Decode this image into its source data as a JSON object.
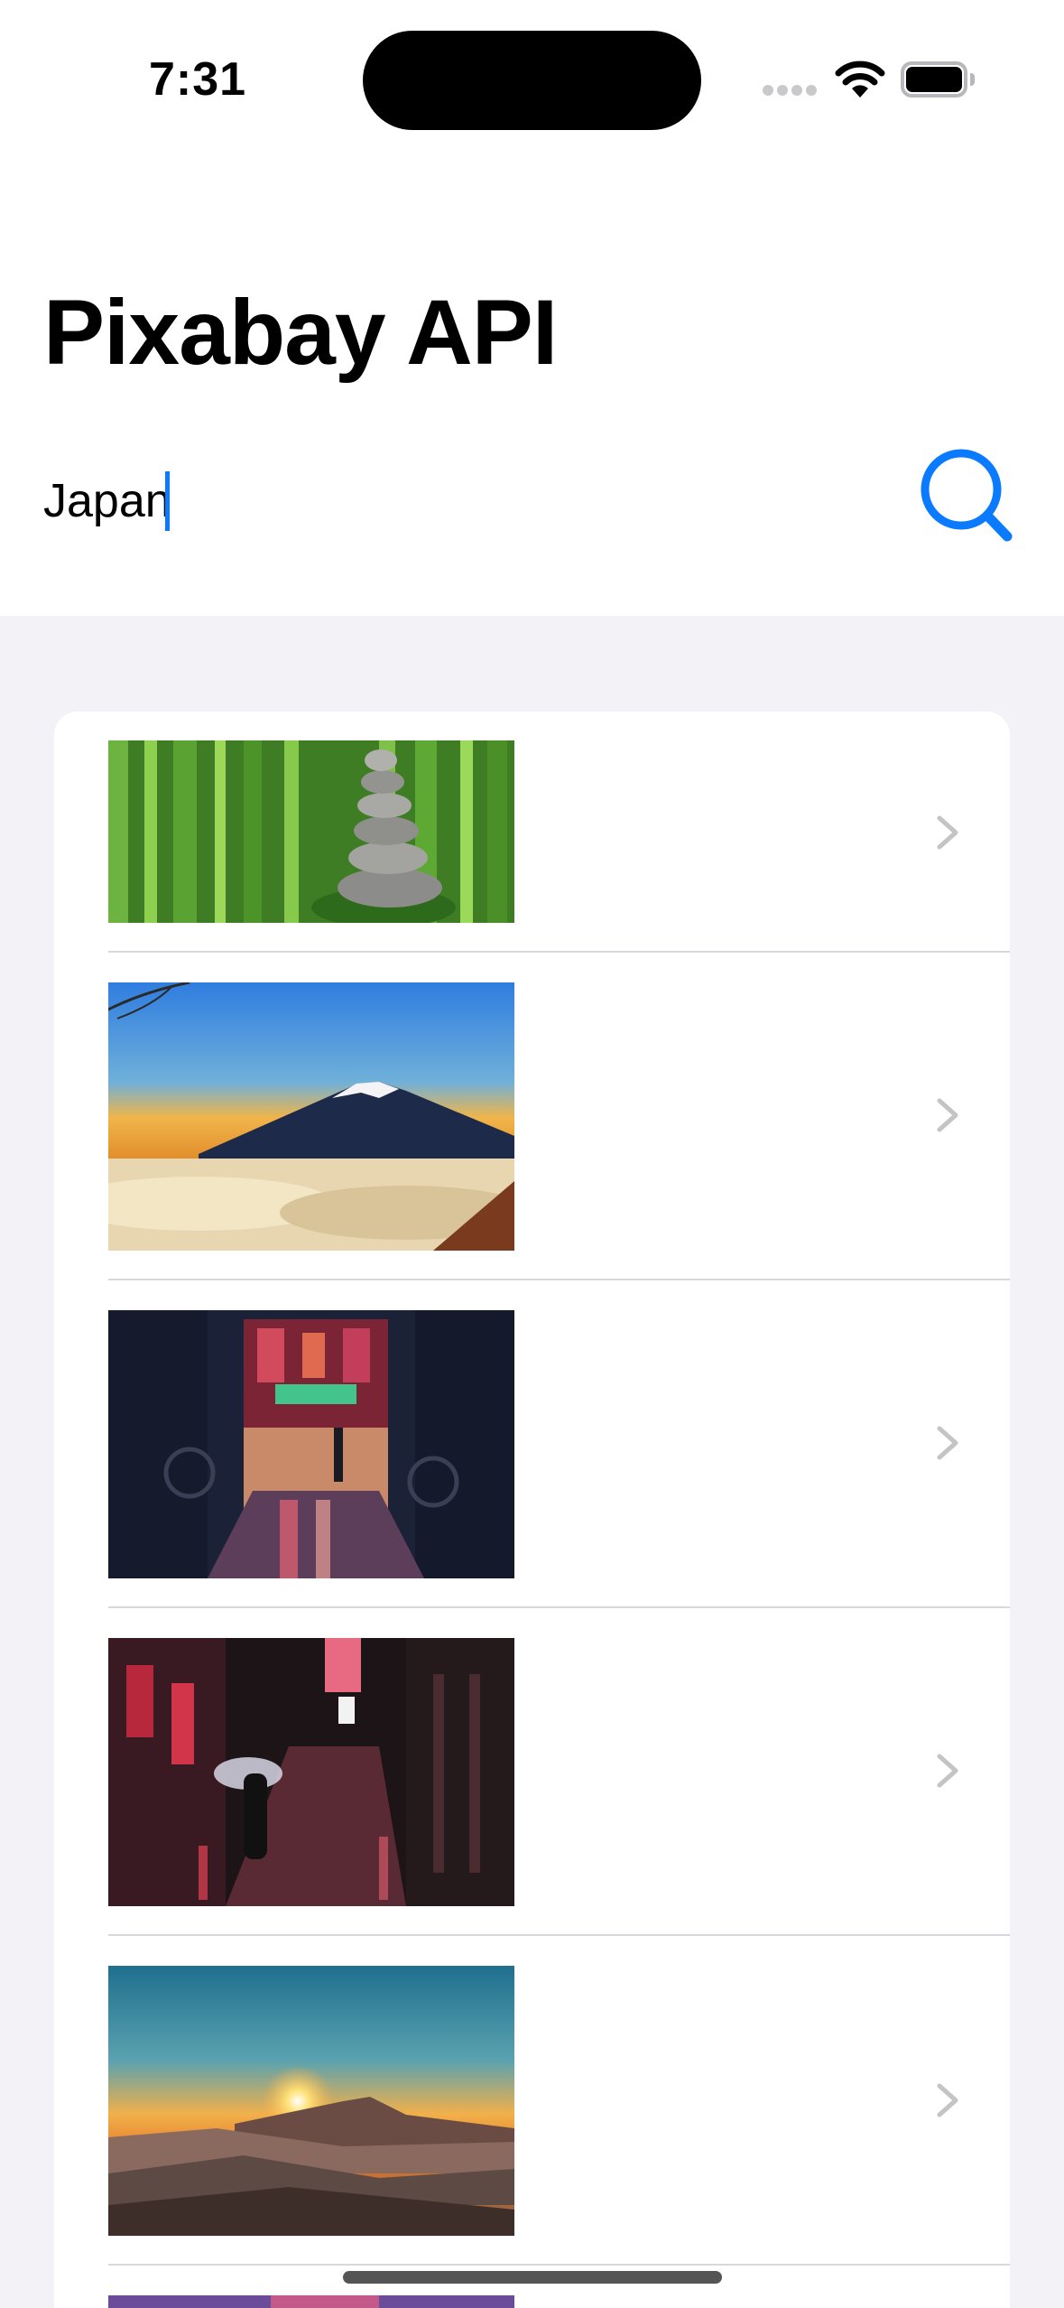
{
  "status": {
    "time": "7:31"
  },
  "header": {
    "title": "Pixabay API"
  },
  "search": {
    "value": "Japan",
    "button_icon": "magnifying-glass-icon",
    "accent_color": "#0A7AFF"
  },
  "results": [
    {
      "subject": "bamboo-with-stone-stack",
      "chevron": "chevron-right-icon"
    },
    {
      "subject": "mount-fuji-sunset",
      "chevron": "chevron-right-icon"
    },
    {
      "subject": "neon-alley-night",
      "chevron": "chevron-right-icon"
    },
    {
      "subject": "red-lantern-street-umbrella",
      "chevron": "chevron-right-icon"
    },
    {
      "subject": "mount-fuji-sunrise-mountains",
      "chevron": "chevron-right-icon"
    },
    {
      "subject": "partial-next-result"
    }
  ],
  "colors": {
    "list_background": "#F2F2F7",
    "divider": "#D8D8DC",
    "chevron": "#C4C4C7"
  }
}
